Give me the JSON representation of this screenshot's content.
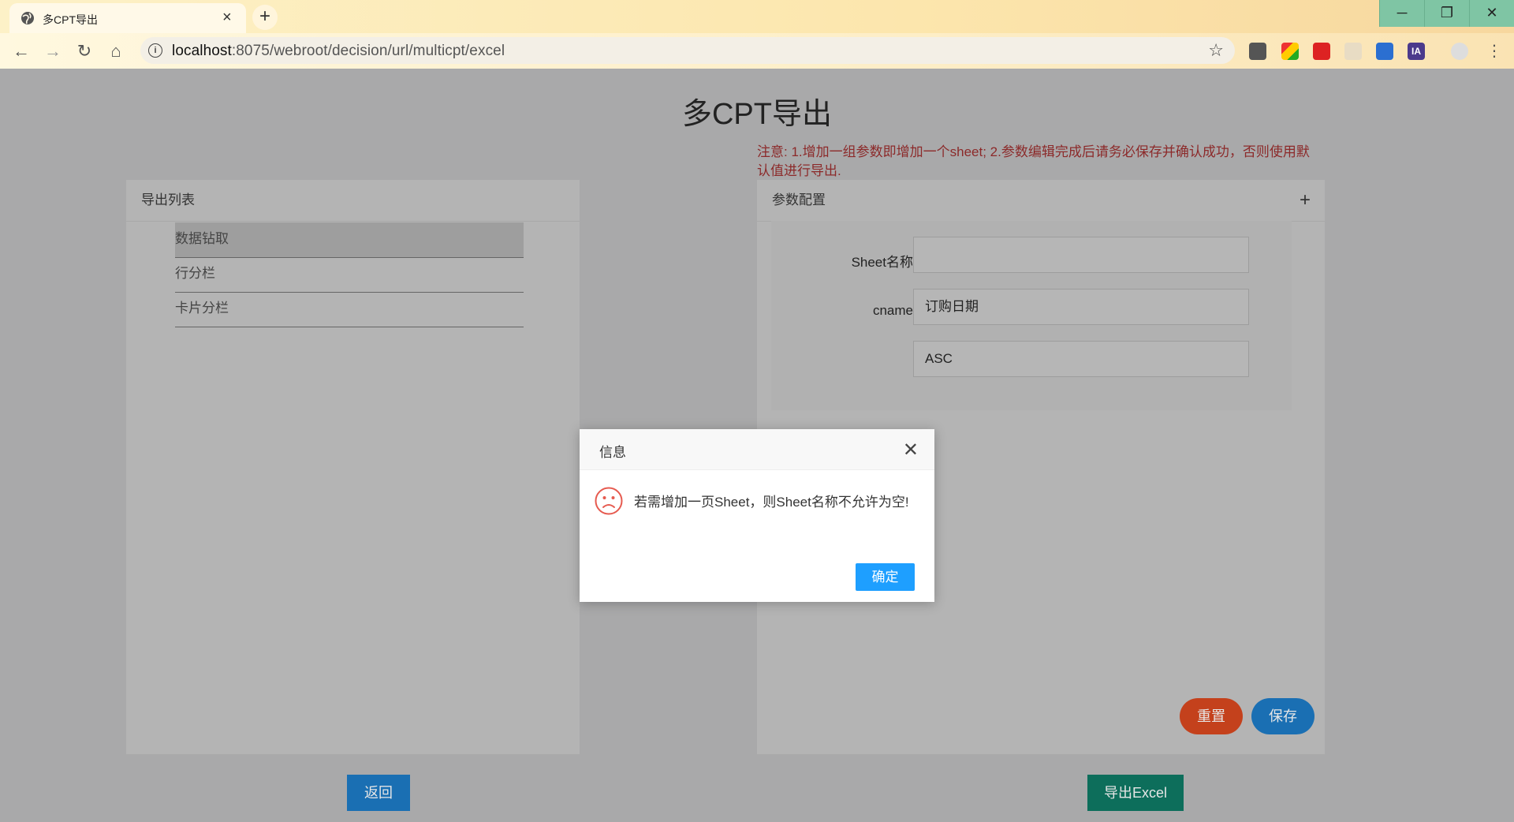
{
  "browser": {
    "tab_title": "多CPT导出",
    "tab_close": "×",
    "new_tab": "+",
    "url_host": "localhost",
    "url_path": ":8075/webroot/decision/url/multicpt/excel",
    "window": {
      "minimize": "─",
      "maximize": "❐",
      "close": "✕"
    },
    "nav": {
      "back": "←",
      "forward": "→",
      "reload": "↻",
      "home": "⌂"
    },
    "extensions": [
      "IA"
    ]
  },
  "page": {
    "title": "多CPT导出",
    "notice": "注意: 1.增加一组参数即增加一个sheet; 2.参数编辑完成后请务必保存并确认成功，否则使用默认值进行导出.",
    "export_list": {
      "header": "导出列表",
      "items": [
        "数据钻取",
        "行分栏",
        "卡片分栏"
      ]
    },
    "param_config": {
      "header": "参数配置",
      "add_label": "+",
      "fields": [
        {
          "label": "Sheet名称",
          "value": ""
        },
        {
          "label": "cname",
          "value": "订购日期"
        },
        {
          "label": "",
          "value": "ASC"
        }
      ],
      "reset_label": "重置",
      "save_label": "保存"
    },
    "back_label": "返回",
    "export_label": "导出Excel"
  },
  "dialog": {
    "title": "信息",
    "close": "✕",
    "message": "若需增加一页Sheet，则Sheet名称不允许为空!",
    "ok_label": "确定"
  },
  "colors": {
    "reset": "#c4411c",
    "save": "#1a6fb3",
    "back": "#1a6fb3",
    "export": "#0d6e5b",
    "ok": "#1e9fff",
    "notice": "#8c2a2a"
  }
}
